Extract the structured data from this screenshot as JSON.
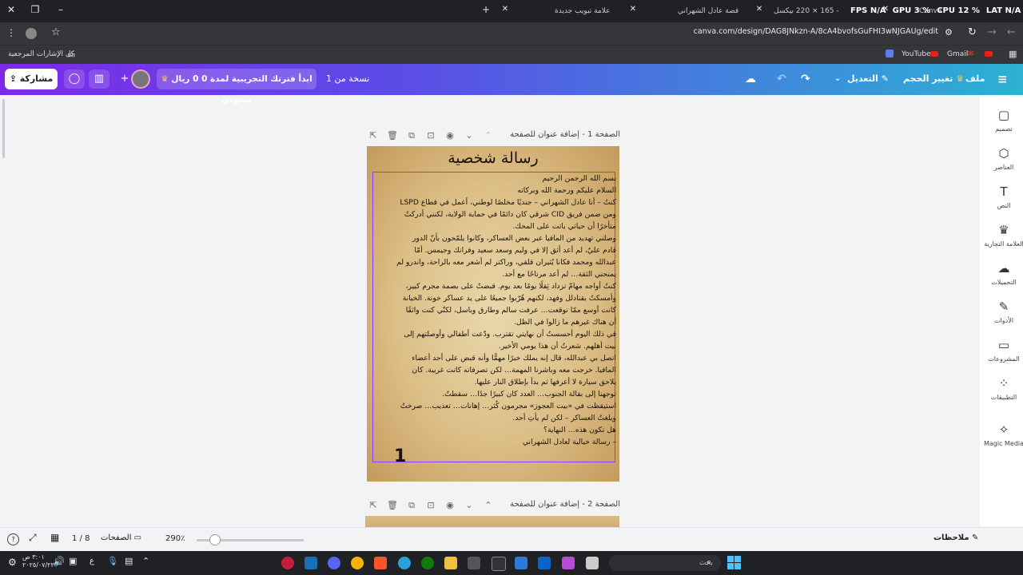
{
  "browser": {
    "tabs": [
      {
        "label": "علامة تبويب جديدة"
      },
      {
        "label": "قصة عادل الشهراني"
      },
      {
        "label": "تصميم بدون عنوان - 165 × 220 بيكسل"
      },
      {
        "label": "Canva"
      }
    ],
    "overlay": {
      "fps": "FPS N/A",
      "gpu": "GPU 3 %",
      "cpu": "CPU 12 %",
      "lat": "LAT N/A"
    },
    "url": "canva.com/design/DAG8JNkzn-A/8cA4bvofsGuFHI3wNJGAUg/edit",
    "bookmarks": {
      "all_label": "كل الإشارات المرجعية",
      "youtube": "YouTube",
      "gmail": "Gmail"
    }
  },
  "canva_header": {
    "menu_file": "ملف",
    "resize": "تغيير الحجم",
    "editing": "التعديل",
    "trial": "ابدأ فترتك التجريبية لمدة 0 0 ريال سعودي",
    "copy_label": "نسخة من 1",
    "share": "مشاركة"
  },
  "sidebar": {
    "items": [
      {
        "label": "تصميم"
      },
      {
        "label": "العناصر"
      },
      {
        "label": "النص"
      },
      {
        "label": "العلامة التجارية"
      },
      {
        "label": "التحميلات"
      },
      {
        "label": "الأدوات"
      },
      {
        "label": "المشروعات"
      },
      {
        "label": "التطبيقات"
      },
      {
        "label": "Magic Media"
      }
    ]
  },
  "page1": {
    "header": "الصفحة 1 - إضافة عنوان للصفحة",
    "title": "رسالة شخصية",
    "lines": [
      "بسم الله الرحمن الرحيم",
      "السلام عليكم ورحمة الله وبركاته",
      "كنتُ – أنا عادل الشهراني – جنديًا مخلصًا لوطني، أعمل في قطاع LSPD",
      "ومن ضمن فريق CID شرقي كان دائمًا في حماية الولاية، لكنني أدركتُ",
      "متأخرًا أن حياتي باتت على المحك.",
      "وصلني تهديد من المافيا عبر بعض العساكر، وكانوا يلمّحون بأنّ الدور",
      "قادم عليّ، لم أعد أثق إلا في وليم وسعد سعيد وفرانك وجيمس. أمّا",
      "عبدالله ومحمد فكانا يُثيران قلقي، وراكتر لم أشعر معه بالراحة، واندرو لم",
      "يمنحني الثقة… لم أعد مرتاحًا مع أحد.",
      "كنتُ أواجه مهامّ تزداد ثِقلًا يومًا بعد يوم. قبضتُ على بصمة مجرم كبير،",
      "وأمسكتُ بقنادلل وفهد، لكنهم هُرّبوا جميعًا على يد عساكر خونة. الخيانة",
      "كانت أوسع ممّا توقعت… عرفت سالم وطارق وباسل، لكنّي كنت واثقًا",
      "أن هناك غيرهم ما زالوا في الظل.",
      "في ذلك اليوم أحسستُ أن نهايتي تقترب. ودّعت أطفالي وأوصلتهم إلى",
      "بيت أهلهم. شعرتُ أن هذا يومي الأخير.",
      "اتصل بي عبدالله، قال إنه يملك خبرًا مهمًّا وأنه قبض على أحد أعضاء",
      "المافيا. خرجت معه وباشرنا المهمة… لكن تصرفاته كانت غريبة. كان",
      "يلاحق سيارة لا أعرفها ثم بدأ بإطلاق النار عليها.",
      "توجهنا إلى بقالة الجنوب… العدد كان كبيرًا جدًا… سقطتُ.",
      "استيقظت في «بيت العجوز» مجرمون كُثر… إهانات… تعذيب… صرختُ",
      "وبلغتُ العساكر – لكن لم يأتِ أحد.",
      "هل تكون هذه… النهاية؟",
      "– رسالة خيالية لعادل الشهراني"
    ],
    "page_number": "1"
  },
  "page2": {
    "header": "الصفحة 2 - إضافة عنوان للصفحة"
  },
  "bottom": {
    "notes": "ملاحظات",
    "zoom": "290٪",
    "pages_label": "الصفحات",
    "page_count": "1 / 8"
  },
  "taskbar": {
    "search": "بحث",
    "time": "٣:٠١ ص",
    "date": "٢٠٢٥/٠٧/٢٢",
    "lang": "ع"
  }
}
